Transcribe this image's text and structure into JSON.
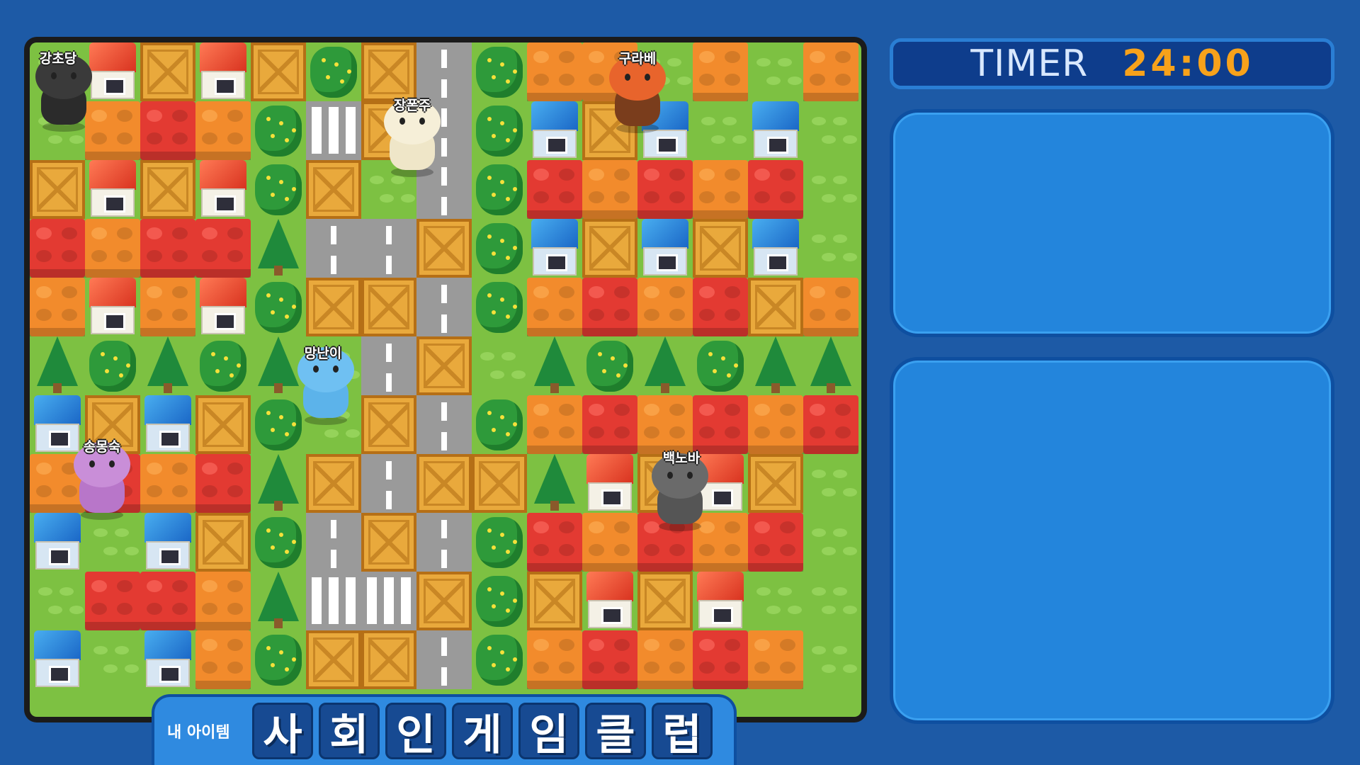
{
  "timer": {
    "label": "TIMER",
    "value": "24:00"
  },
  "item_bar": {
    "label": "내 아이템",
    "slots": [
      "사",
      "회",
      "인",
      "게",
      "임",
      "클",
      "럽"
    ]
  },
  "players": [
    {
      "name": "강초당",
      "animal": "black wolf"
    },
    {
      "name": "장폰주",
      "animal": "sheep"
    },
    {
      "name": "구라베",
      "animal": "red panda"
    },
    {
      "name": "망난이",
      "animal": "blue bird"
    },
    {
      "name": "송몽숙",
      "animal": "purple bear"
    },
    {
      "name": "백노바",
      "animal": "gray cat"
    }
  ],
  "colors": {
    "background": "#1d5aa6",
    "timer_value": "#f7a21b",
    "panel": "#2385dc"
  }
}
